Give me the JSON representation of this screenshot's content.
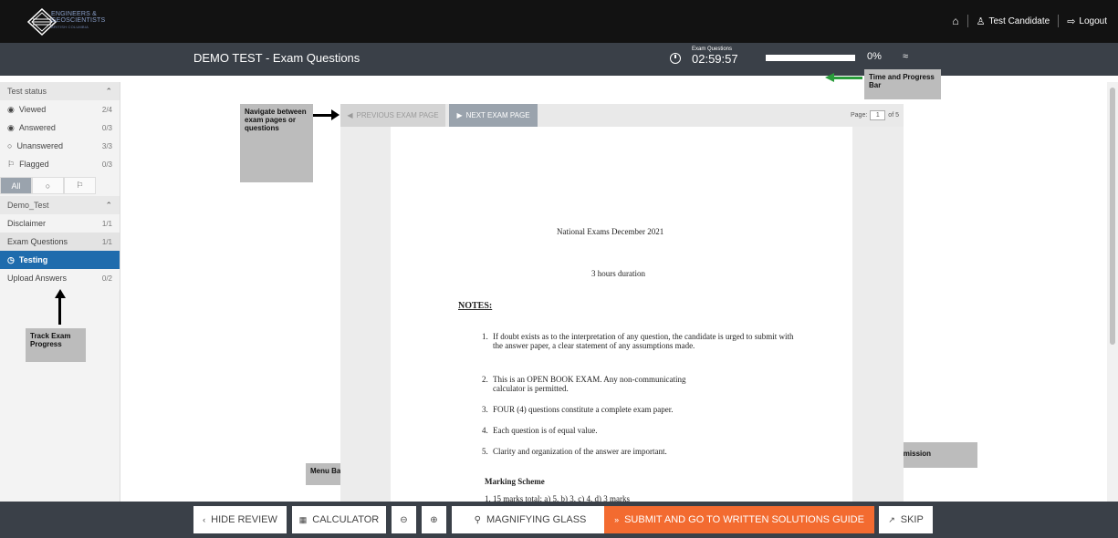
{
  "brand": {
    "line1": "ENGINEERS &",
    "line2": "GEOSCIENTISTS",
    "line3": "BRITISH COLUMBIA"
  },
  "header": {
    "home_icon": "home-icon",
    "user_name": "Test Candidate",
    "logout_label": "Logout"
  },
  "subheader": {
    "title": "DEMO TEST - Exam Questions",
    "timer_label": "Exam Questions",
    "timer_value": "02:59:57",
    "progress_percent": 0,
    "progress_label": "0%"
  },
  "sidebar": {
    "status_header": "Test status",
    "status_items": [
      {
        "label": "Viewed",
        "count": "2/4",
        "icon": "eye-icon"
      },
      {
        "label": "Answered",
        "count": "0/3",
        "icon": "radio-filled-icon"
      },
      {
        "label": "Unanswered",
        "count": "3/3",
        "icon": "radio-empty-icon"
      },
      {
        "label": "Flagged",
        "count": "0/3",
        "icon": "flag-icon"
      }
    ],
    "filters": [
      "All",
      "○",
      "⚐"
    ],
    "section_header": "Demo_Test",
    "sections": [
      {
        "label": "Disclaimer",
        "count": "1/1"
      },
      {
        "label": "Exam Questions",
        "count": "1/1"
      },
      {
        "label": "Testing",
        "count": ""
      },
      {
        "label": "Upload Answers",
        "count": "0/2"
      }
    ]
  },
  "doc_toolbar": {
    "prev_label": "PREVIOUS EXAM PAGE",
    "next_label": "NEXT EXAM PAGE",
    "page_label": "Page:",
    "page_current": "1",
    "page_total": "of 5"
  },
  "document": {
    "heading": "National Exams December 2021",
    "duration": "3 hours duration",
    "notes_title": "NOTES:",
    "notes": [
      {
        "n": "1.",
        "text": "If doubt exists as to the interpretation of any question, the candidate is urged to submit with the answer paper, a clear statement of any assumptions made."
      },
      {
        "n": "2.",
        "text": "This is an OPEN BOOK EXAM. Any non-communicating calculator is permitted."
      },
      {
        "n": "3.",
        "text": "FOUR (4) questions constitute a complete exam paper."
      },
      {
        "n": "4.",
        "text": "Each question is of equal value."
      },
      {
        "n": "5.",
        "text": "Clarity and organization of the answer are important."
      }
    ],
    "marking_title": "Marking Scheme",
    "marking_line": "1.  15 marks total; a) 5, b) 3, c) 4, d) 3 marks"
  },
  "callouts": {
    "navigate": "Navigate between exam pages or questions",
    "track": "Track Exam Progress",
    "time": "Time and Progress Bar",
    "menu": "Menu Bar - Accessibility",
    "exam_nav": "Exam Navigation/Submission"
  },
  "bottombar": {
    "hide_review": "HIDE REVIEW",
    "calculator": "CALCULATOR",
    "magnifier": "MAGNIFYING GLASS",
    "submit": "SUBMIT AND GO TO WRITTEN SOLUTIONS GUIDE",
    "skip": "SKIP"
  },
  "colors": {
    "accent_orange": "#f36b30",
    "active_blue": "#1f6cad",
    "bar_dark": "#3a4048",
    "top_dark": "#121212",
    "progress_green": "#2a8f3f"
  }
}
